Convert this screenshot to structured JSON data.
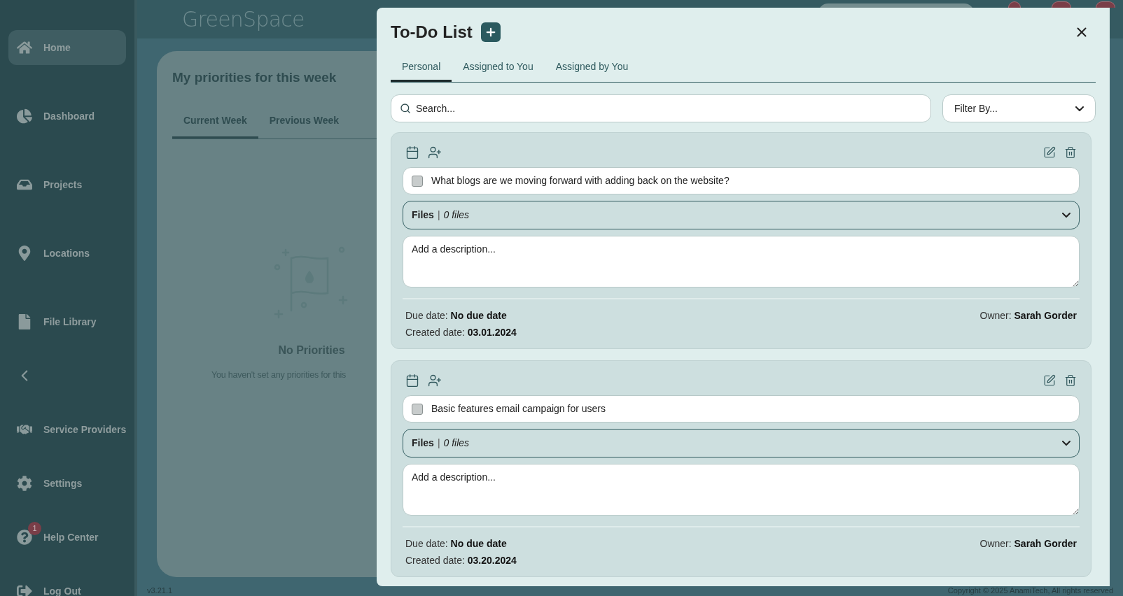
{
  "app": {
    "logo": "GreenSpace",
    "version": "v3.21.1",
    "copyright": "Copyright © 2025 AnamiTech, All rights reserved"
  },
  "sidebar": {
    "items": [
      {
        "kind": "link",
        "label": "Home",
        "selected": true
      },
      {
        "kind": "link",
        "label": "Dashboard",
        "selected": false
      },
      {
        "kind": "link",
        "label": "Projects",
        "selected": false
      },
      {
        "kind": "link",
        "label": "Locations",
        "selected": false
      },
      {
        "kind": "link",
        "label": "File Library",
        "selected": false
      },
      {
        "kind": "collapse"
      },
      {
        "kind": "link",
        "label": "Service Providers",
        "selected": false
      },
      {
        "kind": "link",
        "label": "Settings",
        "selected": false
      },
      {
        "kind": "link",
        "label": "Help Center",
        "selected": false,
        "badge": "1"
      },
      {
        "kind": "link",
        "label": "Log Out",
        "selected": false
      }
    ]
  },
  "priorities": {
    "title": "My priorities for this week",
    "tabs": [
      {
        "label": "Current Week",
        "selected": true
      },
      {
        "label": "Previous Week",
        "selected": false
      }
    ],
    "empty_title": "No Priorities",
    "empty_message": "You haven't set any priorities for this"
  },
  "todo": {
    "title": "To-Do List",
    "tabs": [
      {
        "label": "Personal",
        "selected": true
      },
      {
        "label": "Assigned to You",
        "selected": false
      },
      {
        "label": "Assigned by You",
        "selected": false
      }
    ],
    "search": {
      "placeholder": "Search..."
    },
    "filter": {
      "placeholder": "Filter By..."
    },
    "tasks": [
      {
        "checked": false,
        "title": "What blogs are we moving forward with adding back on the website?",
        "files_label": "Files",
        "files_separator": "|",
        "files_count": "0 files",
        "description_placeholder": "Add a description...",
        "due_label": "Due date:",
        "due": "No due date",
        "created_label": "Created date:",
        "created": "03.01.2024",
        "owner_label": "Owner:",
        "owner": "Sarah Gorder"
      },
      {
        "checked": false,
        "title": "Basic features email campaign for users",
        "files_label": "Files",
        "files_separator": "|",
        "files_count": "0 files",
        "description_placeholder": "Add a description...",
        "due_label": "Due date:",
        "due": "No due date",
        "created_label": "Created date:",
        "created": "03.20.2024",
        "owner_label": "Owner:",
        "owner": "Sarah Gorder"
      }
    ]
  }
}
